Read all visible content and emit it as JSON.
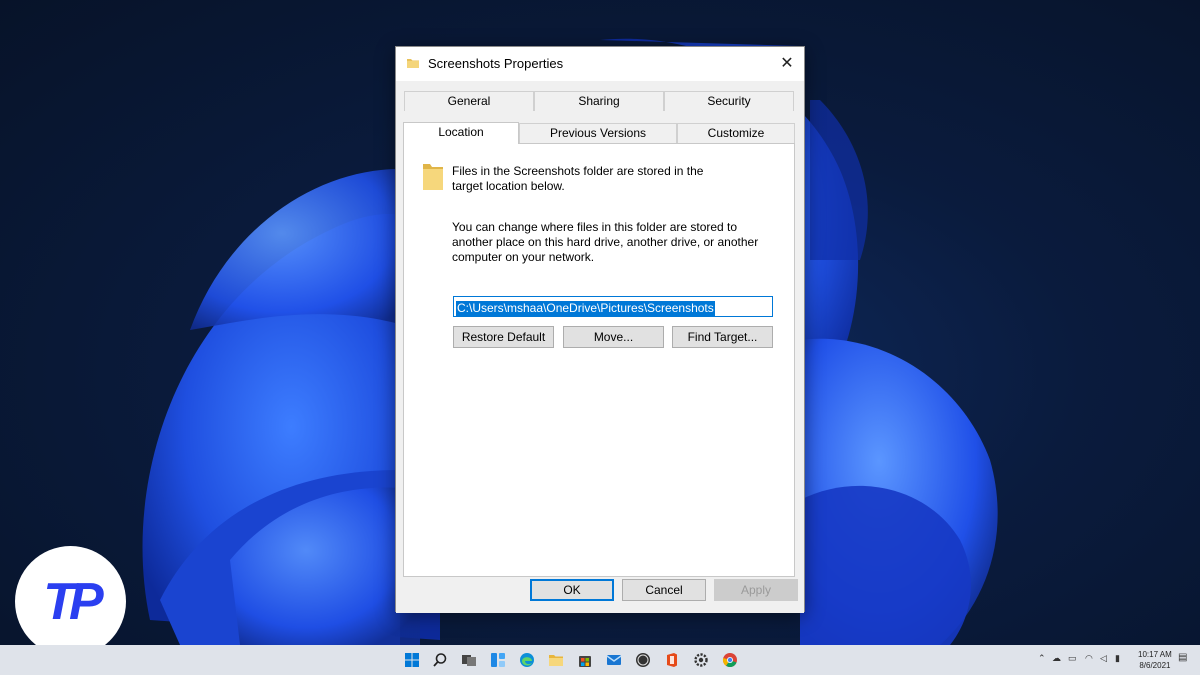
{
  "dialog": {
    "title": "Screenshots Properties",
    "close_glyph": "✕",
    "tabs_row1": [
      "General",
      "Sharing",
      "Security"
    ],
    "tabs_row2": [
      "Location",
      "Previous Versions",
      "Customize"
    ],
    "active_tab": "Location",
    "info_line1": "Files in the Screenshots folder are stored in the",
    "info_line2": "target location below.",
    "desc_line1": "You can change where files in this folder are stored to",
    "desc_line2": "another place on this hard drive, another drive, or another",
    "desc_line3": "computer on your network.",
    "path_value": "C:\\Users\\mshaa\\OneDrive\\Pictures\\Screenshots",
    "buttons": {
      "restore_default": "Restore Default",
      "move": "Move...",
      "find_target": "Find Target...",
      "ok": "OK",
      "cancel": "Cancel",
      "apply": "Apply"
    }
  },
  "logo": {
    "text": "TP"
  },
  "taskbar": {
    "clock_time": "10:17 AM",
    "clock_date": "8/6/2021",
    "icons": [
      "windows-start-icon",
      "search-icon",
      "task-view-icon",
      "widgets-icon",
      "edge-icon",
      "file-explorer-icon",
      "store-icon",
      "mail-icon",
      "dell-icon",
      "office-icon",
      "settings-icon",
      "chrome-icon"
    ]
  },
  "colors": {
    "accent": "#0078d7",
    "dialog_bg": "#f0f0f0",
    "folder": "#e8c15a",
    "logo_blue": "#2b3ff0"
  }
}
